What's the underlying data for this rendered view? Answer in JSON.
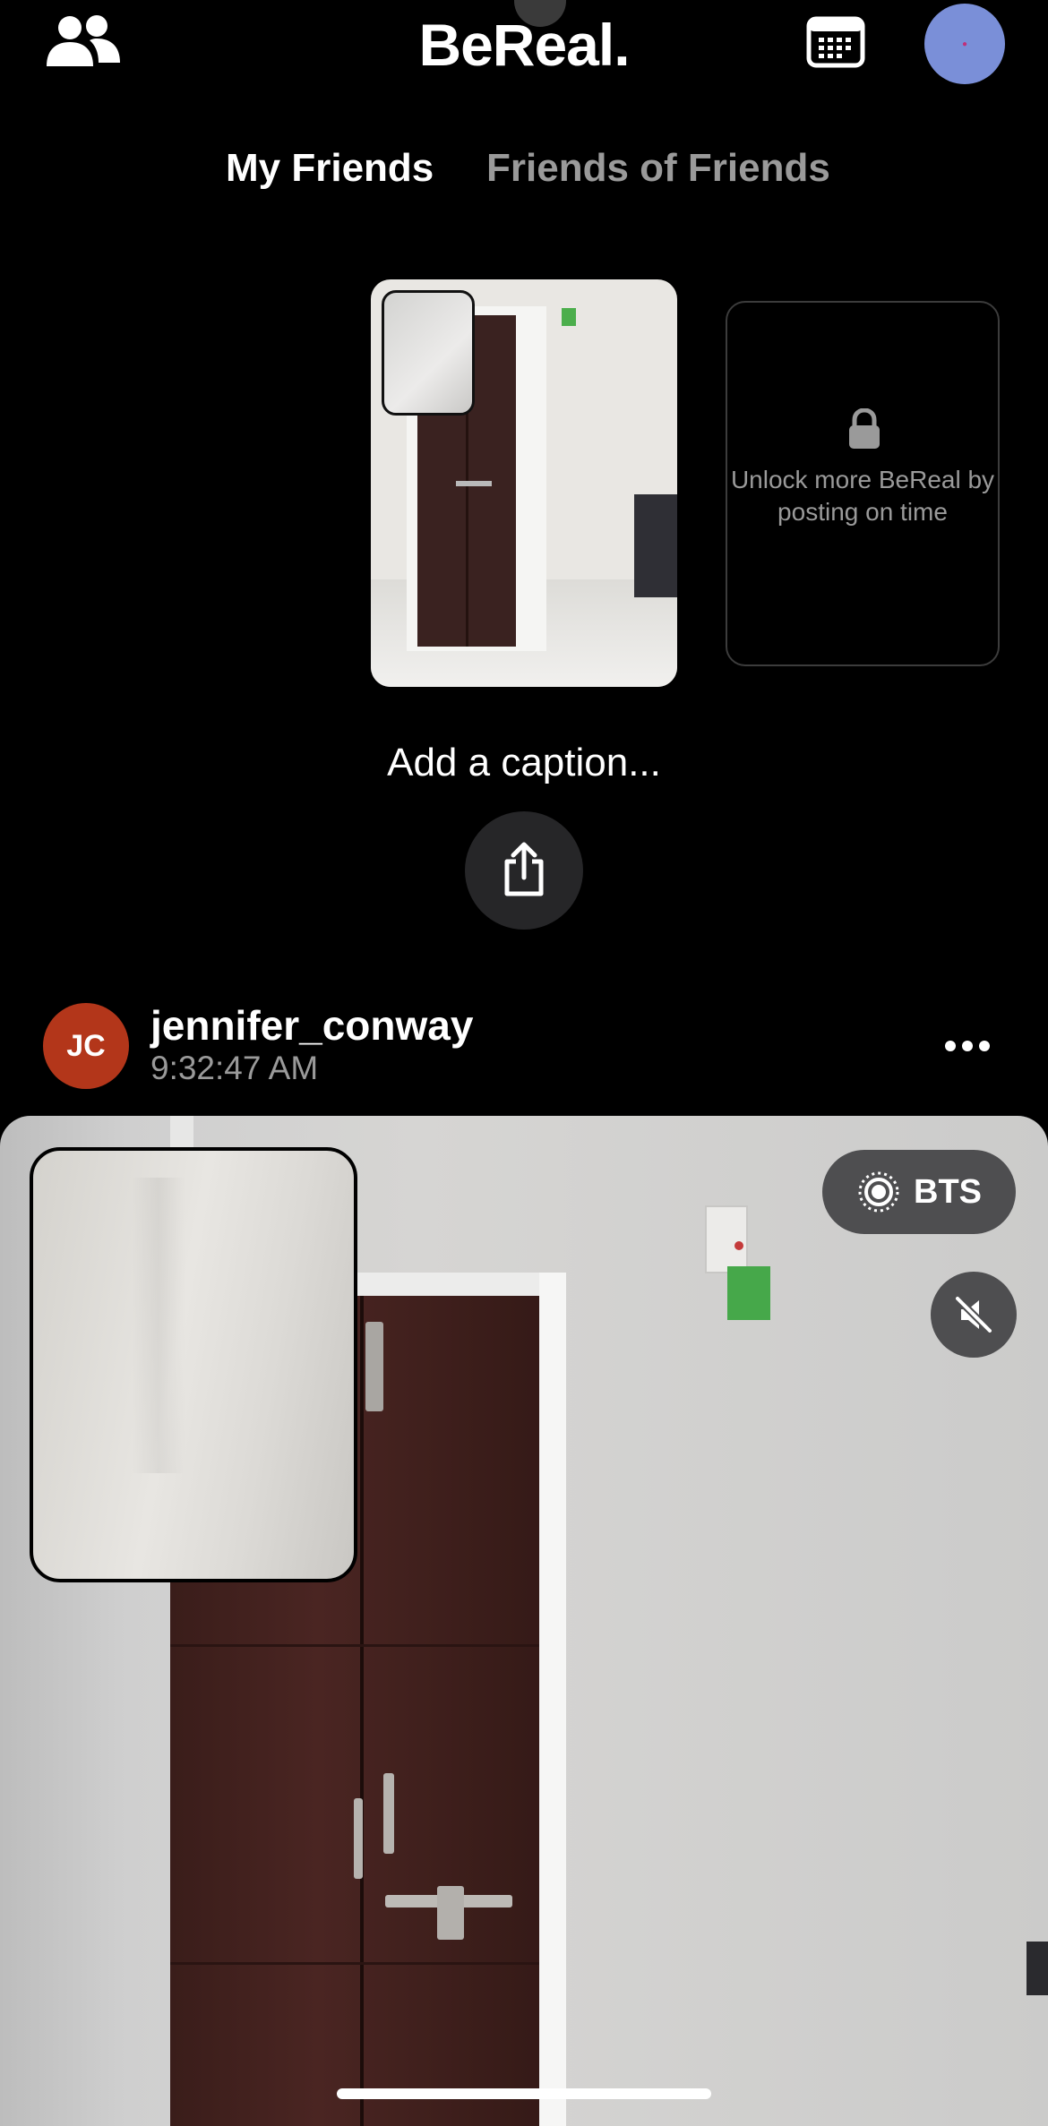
{
  "header": {
    "title": "BeReal.",
    "friends_icon": "friends-icon",
    "calendar_icon": "calendar-icon",
    "profile_avatar_color": "#7a8fd8"
  },
  "tabs": {
    "my_friends": "My Friends",
    "friends_of_friends": "Friends of Friends"
  },
  "my_post": {
    "locked_text": "Unlock more BeReal by posting on time",
    "lock_icon": "lock-icon",
    "caption_placeholder": "Add a caption...",
    "share_icon": "share-icon"
  },
  "feed_post": {
    "avatar_initials": "JC",
    "avatar_color": "#b3361a",
    "username": "jennifer_conway",
    "time": "9:32:47 AM",
    "more_icon": "more-icon",
    "bts_label": "BTS",
    "bts_icon": "bts-record-icon",
    "mute_icon": "speaker-muted-icon"
  }
}
